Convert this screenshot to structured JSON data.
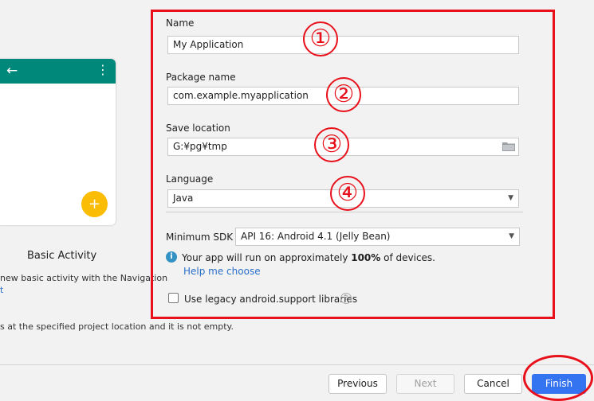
{
  "form": {
    "name_label": "Name",
    "name_value": "My Application",
    "package_label": "Package name",
    "package_value": "com.example.myapplication",
    "save_label": "Save location",
    "save_value": "G:¥pg¥tmp",
    "language_label": "Language",
    "language_value": "Java",
    "min_sdk_label": "Minimum SDK",
    "min_sdk_value": "API 16: Android 4.1 (Jelly Bean)",
    "info_prefix": "Your app will run on approximately ",
    "info_percent": "100%",
    "info_suffix": " of devices.",
    "help_link": "Help me choose",
    "legacy_checkbox_label": "Use legacy android.support libraries",
    "legacy_checked": false
  },
  "annotations": [
    "①",
    "②",
    "③",
    "④"
  ],
  "preview": {
    "activity_title": "Basic Activity",
    "activity_desc": "new basic activity with the Navigation",
    "activity_desc_cont": "t",
    "warning": "s at the specified project location and it is not empty."
  },
  "buttons": {
    "previous": "Previous",
    "next": "Next",
    "cancel": "Cancel",
    "finish": "Finish"
  },
  "colors": {
    "accent": "#3574f0",
    "annotation_red": "#e8111b",
    "toolbar_teal": "#00897b",
    "fab_yellow": "#fbbc04"
  }
}
